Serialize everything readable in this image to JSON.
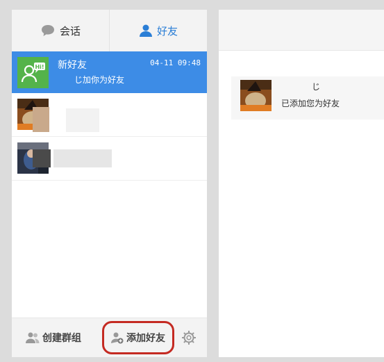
{
  "tabs": {
    "chat": "会话",
    "friends": "好友"
  },
  "friend_list": {
    "new_friend": {
      "name": "新好友",
      "time": "04-11 09:48",
      "message": "じ加你为好友"
    }
  },
  "footer": {
    "create_group": "创建群组",
    "add_friend": "添加好友"
  },
  "detail": {
    "requester_name": "じ",
    "message": "已添加您为好友"
  },
  "colors": {
    "active_bg": "#3d8ce6",
    "accent": "#2a7ed6",
    "highlight_ring": "#c42a22",
    "new_friend_icon_bg": "#54b34a"
  },
  "icons": [
    "chat-bubble-icon",
    "person-icon",
    "new-friend-icon",
    "group-icon",
    "add-person-icon",
    "gear-icon"
  ]
}
